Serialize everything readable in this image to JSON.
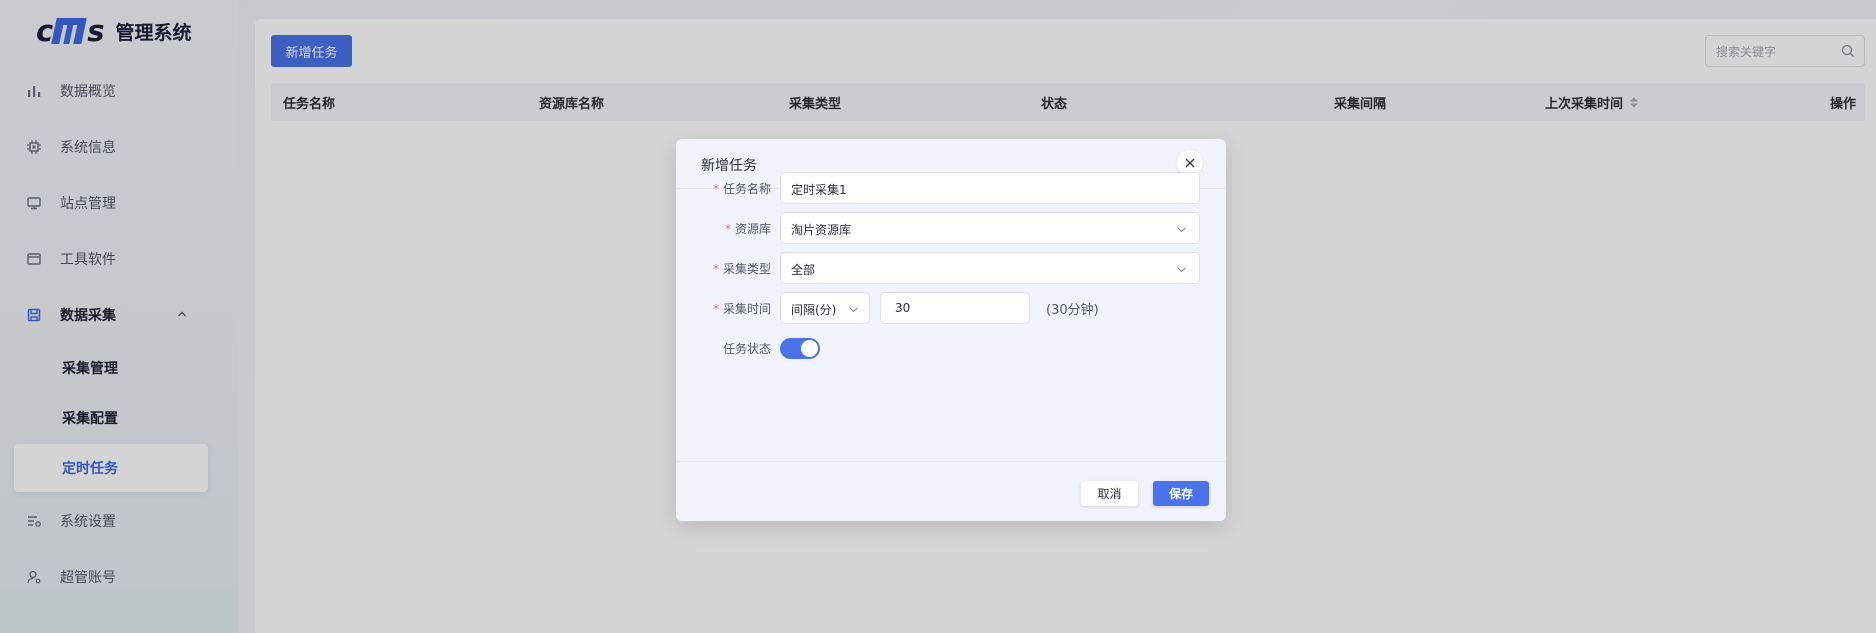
{
  "app": {
    "logo_mark": [
      "c",
      "s"
    ],
    "title": "管理系统"
  },
  "sidebar": {
    "items": [
      {
        "label": "数据概览",
        "icon": "bar-chart-icon"
      },
      {
        "label": "系统信息",
        "icon": "chip-icon"
      },
      {
        "label": "站点管理",
        "icon": "monitor-icon"
      },
      {
        "label": "工具软件",
        "icon": "window-icon"
      },
      {
        "label": "数据采集",
        "icon": "save-icon",
        "expanded": true
      },
      {
        "label": "系统设置",
        "icon": "settings-sliders-icon"
      },
      {
        "label": "超管账号",
        "icon": "user-gear-icon"
      }
    ],
    "sub_items": [
      {
        "label": "采集管理"
      },
      {
        "label": "采集配置"
      },
      {
        "label": "定时任务",
        "active": true
      }
    ]
  },
  "toolbar": {
    "add_label": "新增任务",
    "search_placeholder": "搜索关键字"
  },
  "table": {
    "columns": [
      "任务名称",
      "资源库名称",
      "采集类型",
      "状态",
      "采集间隔",
      "上次采集时间",
      "操作"
    ]
  },
  "dialog": {
    "title": "新增任务",
    "fields": {
      "name": {
        "label": "任务名称",
        "value": "定时采集1"
      },
      "repo": {
        "label": "资源库",
        "value": "淘片资源库"
      },
      "type": {
        "label": "采集类型",
        "value": "全部"
      },
      "time": {
        "label": "采集时间",
        "mode": "间隔(分)",
        "value": "30",
        "hint": "(30分钟)"
      },
      "status": {
        "label": "任务状态",
        "on": true
      }
    },
    "cancel_label": "取消",
    "save_label": "保存"
  },
  "colors": {
    "accent": "#4a72ea",
    "required": "#f56c6c"
  }
}
